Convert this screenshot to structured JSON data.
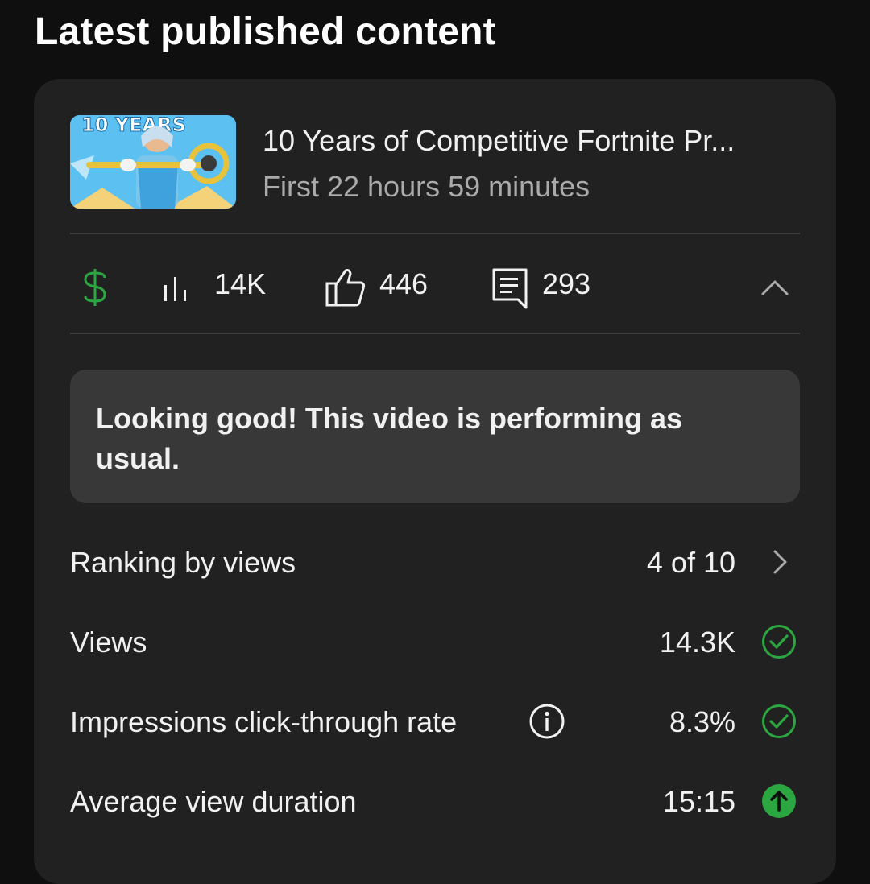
{
  "section": {
    "title": "Latest published content"
  },
  "video": {
    "thumbnail_text": "10 YEARS",
    "title": "10 Years of Competitive Fortnite Pr...",
    "subtitle": "First 22 hours 59 minutes"
  },
  "stats": {
    "monetization_icon": "dollar-icon",
    "views_icon": "bar-chart-icon",
    "views": "14K",
    "likes_icon": "thumbs-up-icon",
    "likes": "446",
    "comments_icon": "comment-icon",
    "comments": "293",
    "collapse_icon": "chevron-up-icon"
  },
  "notice": {
    "text": "Looking good! This video is performing as usual."
  },
  "metrics": [
    {
      "label": "Ranking by views",
      "value": "4 of 10",
      "status_icon": "chevron-right-icon"
    },
    {
      "label": "Views",
      "value": "14.3K",
      "status_icon": "check-circle-icon"
    },
    {
      "label": "Impressions click-through rate",
      "value": "8.3%",
      "status_icon": "check-circle-icon",
      "info_icon": "info-icon"
    },
    {
      "label": "Average view duration",
      "value": "15:15",
      "status_icon": "arrow-up-circle-icon"
    }
  ],
  "colors": {
    "background": "#0f0f0f",
    "card": "#212121",
    "notice": "#383838",
    "accent_green": "#2ba640",
    "secondary_text": "#aaaaaa"
  }
}
